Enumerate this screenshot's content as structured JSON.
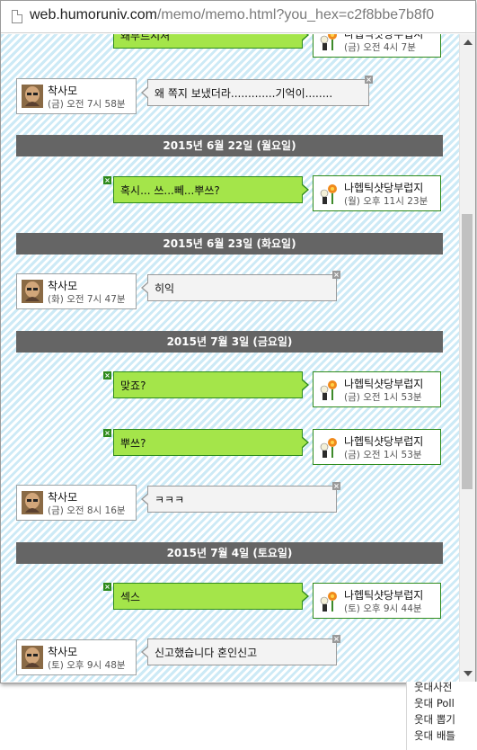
{
  "browser": {
    "url_host": "web.humoruniv.com",
    "url_path": "/memo/memo.html?you_hex=c2f8bbe7b8f0"
  },
  "me": {
    "name": "나헵틱샷당부럽지"
  },
  "them": {
    "name": "착사모"
  },
  "close_glyph": "×",
  "partial_top": {
    "text": "왜부르시셔",
    "time": "(금) 오전 4시 7분"
  },
  "entries": [
    {
      "left_time": "(금) 오전 7시 58분",
      "left_text": "왜 쪽지 보냈더라.............기억이........"
    },
    {
      "date": "2015년 6월 22일 (월요일)"
    },
    {
      "right_text": "혹시... 쓰...뻬...뿌쓰?",
      "right_time": "(월) 오후 11시 23분"
    },
    {
      "date": "2015년 6월 23일 (화요일)"
    },
    {
      "left_time": "(화) 오전 7시 47분",
      "left_text": "히익"
    },
    {
      "date": "2015년 7월 3일 (금요일)"
    },
    {
      "right_text": "맞죠?",
      "right_time": "(금) 오전 1시 53분"
    },
    {
      "right_text": "뿌쓰?",
      "right_time": "(금) 오전 1시 53분"
    },
    {
      "left_time": "(금) 오전 8시 16분",
      "left_text": "ㅋㅋㅋ"
    },
    {
      "date": "2015년 7월 4일 (토요일)"
    },
    {
      "right_text": "섹스",
      "right_time": "(토) 오후 9시 44분"
    },
    {
      "left_time": "(토) 오후 9시 48분",
      "left_text": "신고했습니다 혼인신고"
    }
  ],
  "sidebar": {
    "items": [
      "웃대사전",
      "웃대 Poll",
      "웃대 뽑기",
      "웃대 배틀"
    ]
  },
  "colors": {
    "stripe": "#cdeaf6",
    "divider": "#656565",
    "bubble_me": "#a4e54a",
    "border_me": "#2e8b1c",
    "bubble_them": "#f3f3f3"
  },
  "icons": {
    "avatar_them": "bald-man-avatar-icon",
    "avatar_me": "flower-character-avatar-icon",
    "page": "page-icon"
  }
}
